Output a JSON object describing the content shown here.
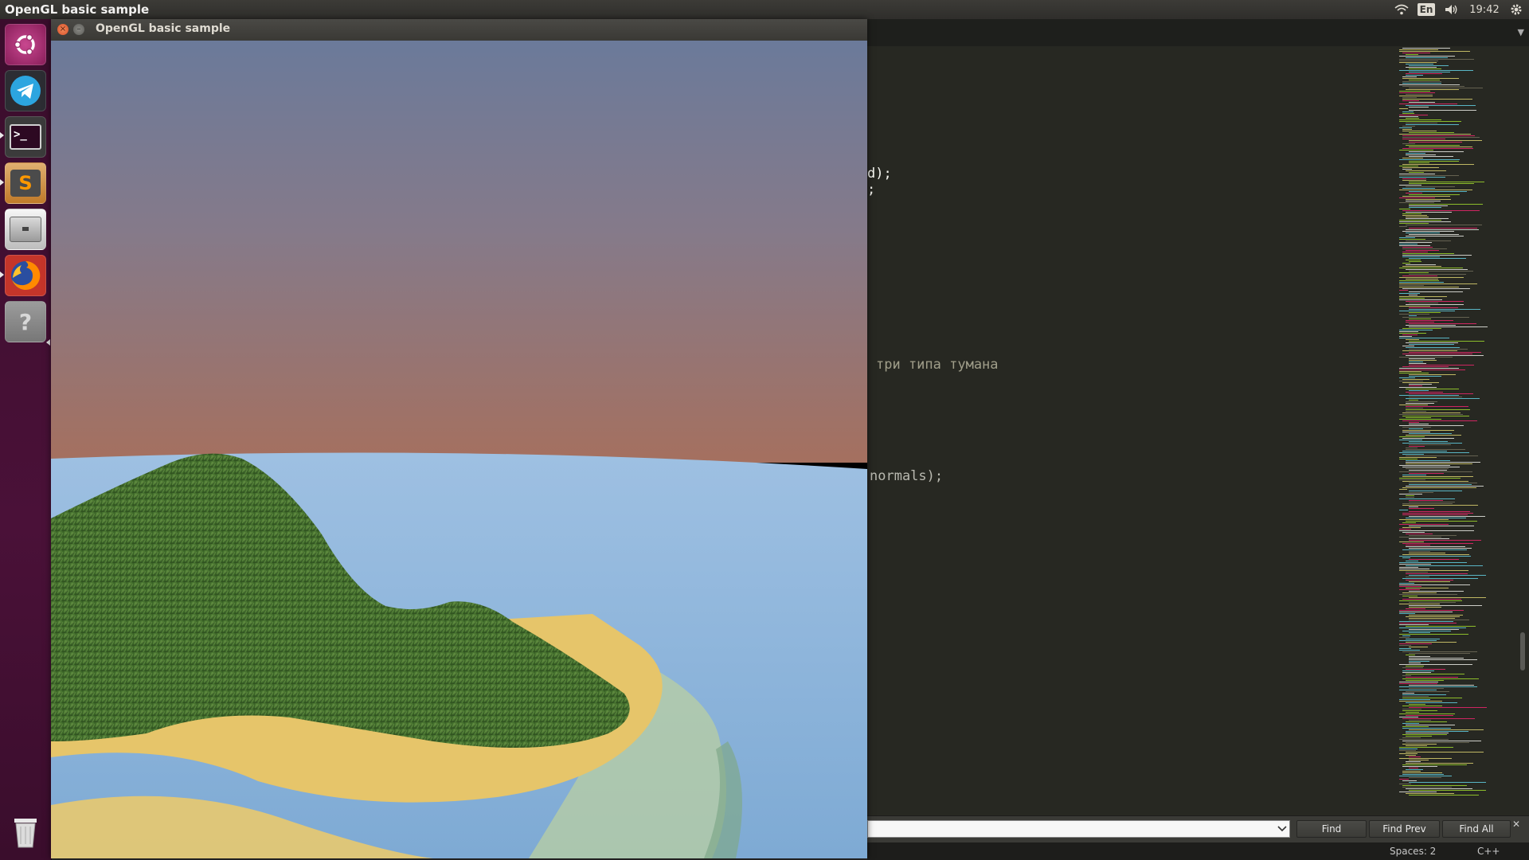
{
  "top_panel": {
    "app_title": "OpenGL basic sample",
    "keyboard_layout": "En",
    "clock": "19:42"
  },
  "launcher": {
    "items": [
      {
        "name": "ubuntu-dash-icon"
      },
      {
        "name": "telegram-icon"
      },
      {
        "name": "terminal-icon"
      },
      {
        "name": "sublime-text-icon"
      },
      {
        "name": "files-icon"
      },
      {
        "name": "firefox-icon"
      },
      {
        "name": "help-icon"
      },
      {
        "name": "trash-icon"
      }
    ]
  },
  "gl_window": {
    "title": "OpenGL basic sample"
  },
  "editor": {
    "visible_code": [
      {
        "line": "d);"
      },
      {
        "line": ";"
      },
      {
        "line": "три типа тумана"
      },
      {
        "line": "normals);"
      }
    ],
    "tab_dropdown_icon": "▼"
  },
  "find_panel": {
    "input_value": "",
    "buttons": {
      "find": "Find",
      "find_prev": "Find Prev",
      "find_all": "Find All"
    }
  },
  "status_bar": {
    "indentation": "Spaces: 2",
    "syntax": "C++"
  },
  "colors": {
    "sky_top": "#6b7a9a",
    "sky_horizon": "#a5705f",
    "water": "#8fb5d9",
    "grass": "#3f6a2a",
    "sand": "#e6c56a",
    "editor_bg": "#272822",
    "launcher_bg": "#4a1138"
  }
}
